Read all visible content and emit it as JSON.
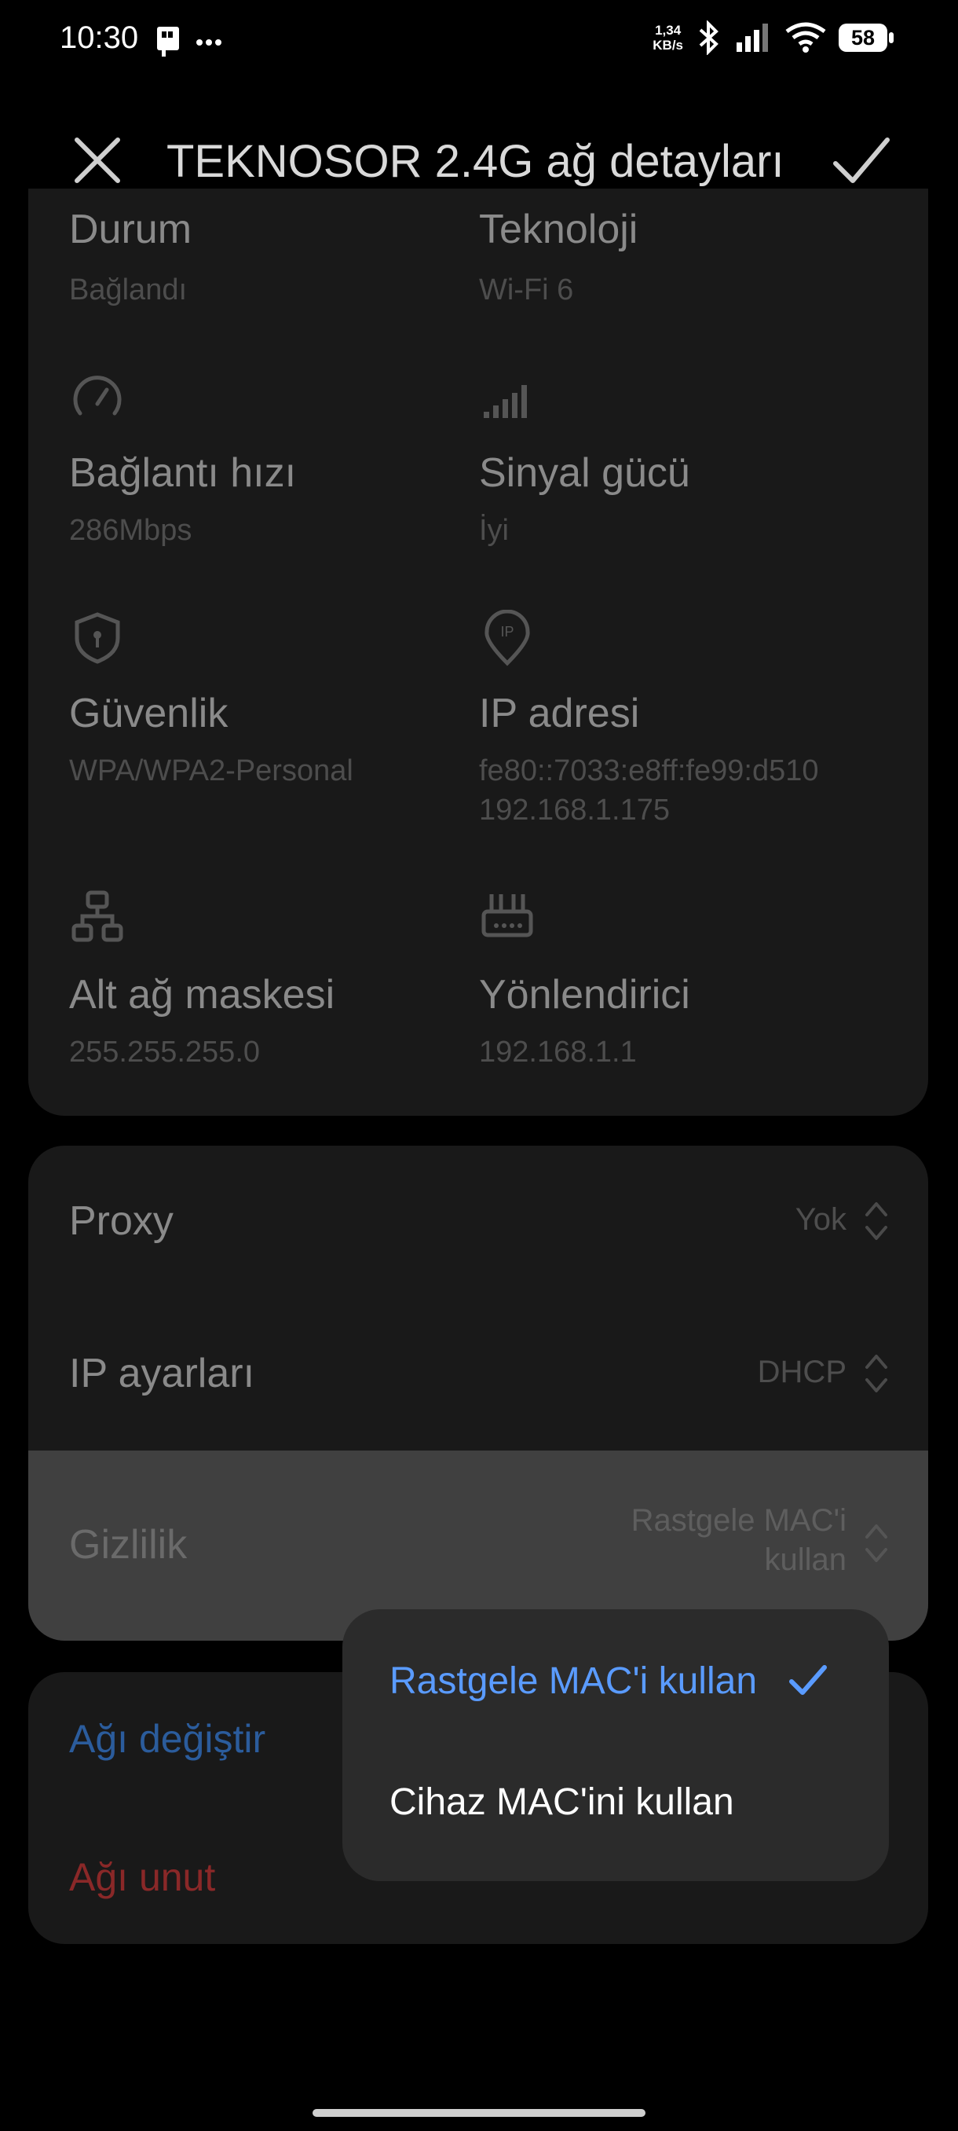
{
  "status_bar": {
    "time": "10:30",
    "net_speed_value": "1,34",
    "net_speed_unit": "KB/s",
    "battery": "58",
    "icons": [
      "sim-card-icon",
      "more-dots-icon",
      "bluetooth-icon",
      "signal-icon",
      "wifi-icon",
      "battery-icon"
    ]
  },
  "header": {
    "title": "TEKNOSOR 2.4G ağ detayları",
    "icons": [
      "close-icon",
      "check-icon"
    ]
  },
  "details": {
    "status": {
      "label": "Durum",
      "value": "Bağlandı"
    },
    "technology": {
      "label": "Teknoloji",
      "value": "Wi-Fi 6"
    },
    "link_speed": {
      "label": "Bağlantı hızı",
      "value": "286Mbps",
      "icon": "speedometer-icon"
    },
    "signal_strength": {
      "label": "Sinyal gücü",
      "value": "İyi",
      "icon": "signal-bars-icon"
    },
    "security": {
      "label": "Güvenlik",
      "value": "WPA/WPA2-Personal",
      "icon": "shield-icon"
    },
    "ip_address": {
      "label": "IP adresi",
      "value_v6": "fe80::7033:e8ff:fe99:d510",
      "value_v4": "192.168.1.175",
      "icon": "ip-pin-icon"
    },
    "subnet_mask": {
      "label": "Alt ağ maskesi",
      "value": "255.255.255.0",
      "icon": "network-icon"
    },
    "router": {
      "label": "Yönlendirici",
      "value": "192.168.1.1",
      "icon": "router-icon"
    }
  },
  "settings": {
    "proxy": {
      "label": "Proxy",
      "value": "Yok"
    },
    "ip_settings": {
      "label": "IP ayarları",
      "value": "DHCP"
    },
    "privacy": {
      "label": "Gizlilik",
      "value_line1": "Rastgele MAC'i",
      "value_line2": "kullan"
    }
  },
  "actions": {
    "change_network": "Ağı değiştir",
    "forget_network": "Ağı unut"
  },
  "privacy_popup": {
    "options": [
      {
        "label": "Rastgele MAC'i kullan",
        "selected": true
      },
      {
        "label": "Cihaz MAC'ini kullan",
        "selected": false
      }
    ],
    "selected_color": "#5a9bff"
  },
  "colors": {
    "background": "#000000",
    "card": "#191919",
    "popup": "#2b2b2b",
    "forget_red": "#8a2828",
    "change_blue": "#2b5c9c"
  }
}
